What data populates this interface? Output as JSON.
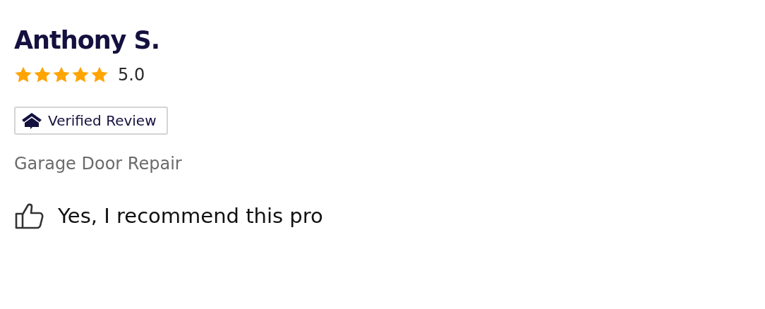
{
  "reviewer": {
    "name": "Anthony S."
  },
  "rating": {
    "stars": 5,
    "score": "5.0"
  },
  "badge": {
    "label": "Verified Review"
  },
  "service": "Garage Door Repair",
  "recommendation": {
    "recommended": true,
    "text": "Yes, I recommend this pro"
  }
}
